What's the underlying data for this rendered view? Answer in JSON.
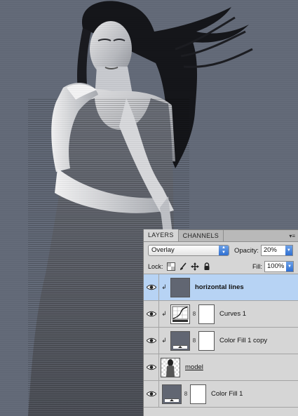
{
  "panel": {
    "tabs": [
      {
        "label": "LAYERS",
        "active": true
      },
      {
        "label": "CHANNELS",
        "active": false
      }
    ],
    "blend_mode": "Overlay",
    "opacity_label": "Opacity:",
    "opacity_value": "20%",
    "lock_label": "Lock:",
    "fill_label": "Fill:",
    "fill_value": "100%"
  },
  "layers": [
    {
      "name": "horizontal lines",
      "selected": true,
      "clipped": true,
      "thumb": "gray-fill",
      "has_mask": false,
      "style": "bold"
    },
    {
      "name": "Curves 1",
      "selected": false,
      "clipped": true,
      "thumb": "curves-adjustment",
      "has_mask": true,
      "style": "normal"
    },
    {
      "name": "Color Fill 1 copy",
      "selected": false,
      "clipped": true,
      "thumb": "color-fill",
      "has_mask": true,
      "style": "normal"
    },
    {
      "name": "model",
      "selected": false,
      "clipped": false,
      "thumb": "model-photo",
      "has_mask": false,
      "style": "underline"
    },
    {
      "name": "Color Fill 1",
      "selected": false,
      "clipped": false,
      "thumb": "color-fill",
      "has_mask": true,
      "style": "normal"
    }
  ],
  "colors": {
    "canvas_background": "#646b79",
    "panel_background": "#d6d6d6",
    "selected_row": "#b7d3f4",
    "accent_blue": "#2f6fd1"
  }
}
